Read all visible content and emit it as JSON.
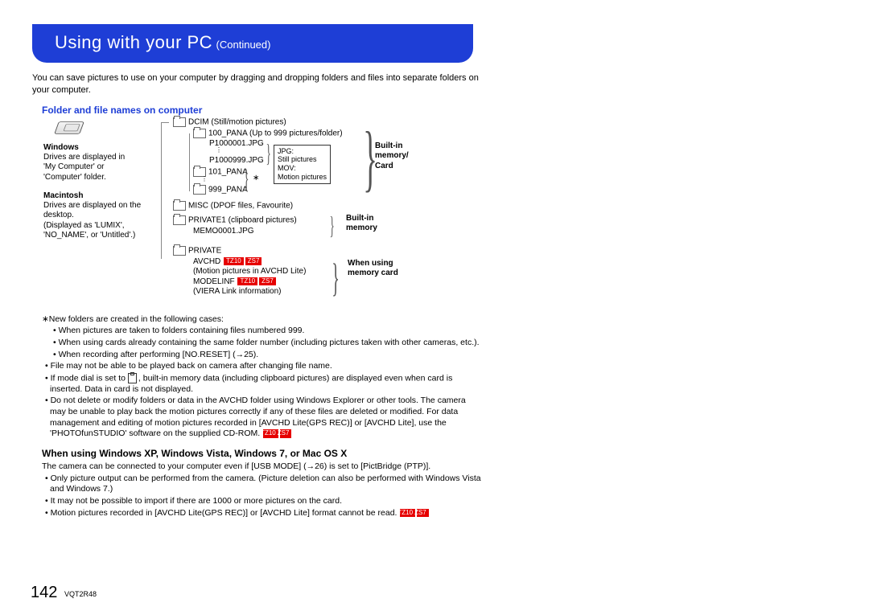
{
  "header": {
    "title_main": "Using with your PC",
    "title_sub": "(Continued)"
  },
  "intro": "You can save pictures to use on your computer by dragging and dropping folders and files into separate folders on your computer.",
  "section1_heading": "Folder and file names on computer",
  "diagram": {
    "windows_h": "Windows",
    "windows_t": "Drives are displayed in 'My Computer' or 'Computer' folder.",
    "mac_h": "Macintosh",
    "mac_t": "Drives are displayed on the desktop.\n(Displayed as 'LUMIX', 'NO_NAME', or 'Untitled'.)",
    "dcim": "DCIM (Still/motion pictures)",
    "pana100": "100_PANA (Up to 999 pictures/folder)",
    "p1": "P1000001.JPG",
    "p999": "P1000999.JPG",
    "pana101": "101_PANA",
    "pana999": "999_PANA",
    "star": "∗",
    "jpg_l": "JPG:",
    "jpg_v": "Still pictures",
    "mov_l": "MOV:",
    "mov_v": "Motion pictures",
    "builtin_card": "Built-in memory/ Card",
    "misc": "MISC (DPOF files, Favourite)",
    "private1": "PRIVATE1 (clipboard pictures)",
    "memo": "MEMO0001.JPG",
    "builtin_mem": "Built-in memory",
    "private": "PRIVATE",
    "avchd": "AVCHD",
    "avchd_sub": "(Motion pictures in AVCHD Lite)",
    "modelinf": "MODELINF",
    "viera": "(VIERA Link information)",
    "when_card": "When using memory card",
    "badge1": "TZ10",
    "badge2": "ZS7"
  },
  "notes": {
    "star_intro": "∗New folders are created in the following cases:",
    "n1": "• When pictures are taken to folders containing files numbered 999.",
    "n2": "• When using cards already containing the same folder number (including pictures taken with other cameras, etc.).",
    "n3": "• When recording after performing [NO.RESET] (→25).",
    "b1": "• File may not be able to be played back on camera after changing file name.",
    "b2a": "• If mode dial is set to ",
    "b2b": ", built-in memory data (including clipboard pictures) are displayed even when card is inserted. Data in card is not displayed.",
    "b3": "• Do not delete or modify folders or data in the AVCHD folder using Windows Explorer or other tools. The camera may be unable to play back the motion pictures correctly if any of these files are deleted or modified. For data management and editing of motion pictures recorded in [AVCHD Lite(GPS REC)] or [AVCHD Lite], use the 'PHOTOfunSTUDIO' software on the supplied CD-ROM."
  },
  "section2_heading": "When using Windows XP, Windows Vista, Windows 7, or Mac OS X",
  "section2": {
    "intro": "The camera can be connected to your computer even if [USB MODE] (→26) is set to [PictBridge (PTP)].",
    "b1": "• Only picture output can be performed from the camera. (Picture deletion can also be performed with Windows Vista and Windows 7.)",
    "b2": "• It may not be possible to import if there are 1000 or more pictures on the card.",
    "b3": "• Motion pictures recorded in [AVCHD Lite(GPS REC)] or [AVCHD Lite] format cannot be read."
  },
  "footer": {
    "page": "142",
    "docid": "VQT2R48"
  }
}
